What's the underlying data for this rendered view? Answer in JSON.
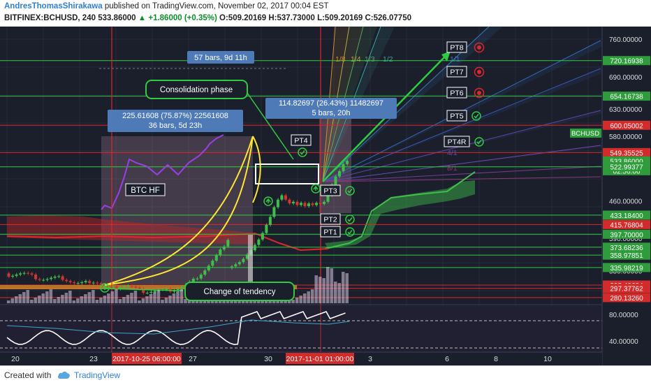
{
  "header": {
    "author": "AndresThomasShirakawa",
    "published_text": "published on TradingView.com, November 02, 2017 00:04 EST",
    "symbol": "BITFINEX:BCHUSD, 240",
    "last": "533.86000",
    "change": "▲ +1.86000 (+0.35%)",
    "ohlc_o": "O:509.20169",
    "ohlc_h": "H:537.73000",
    "ohlc_l": "L:509.20169",
    "ohlc_c": "C:526.07750"
  },
  "footer": {
    "created_with": "Created with",
    "brand": "TradingView"
  },
  "colors": {
    "background": "#1b1f2c",
    "grid": "#2b3142",
    "up": "#3fbf4a",
    "down": "#d0352f",
    "axis_bg": "#1b1f2c",
    "green_line": "#2ecc40",
    "red_line": "#e0262a",
    "yellow": "#ffe534",
    "purple": "#9a3fe6",
    "white": "#ffffff",
    "label_blue": "#4f7ab8"
  },
  "price_axis": {
    "ticks": [
      "760.00000",
      "690.00000",
      "630.00000",
      "580.00000",
      "520.00000",
      "460.00000",
      "390.00000",
      "330.00000"
    ],
    "tags": [
      {
        "v": "720.16938",
        "color": "green"
      },
      {
        "v": "654.16738",
        "color": "green"
      },
      {
        "v": "600.05002",
        "color": "red"
      },
      {
        "v": "549.35525",
        "color": "red"
      },
      {
        "v": "533.86000",
        "color": "green"
      },
      {
        "v": "02:56:06",
        "color": "green"
      },
      {
        "v": "522.99377",
        "color": "green"
      },
      {
        "v": "433.18400",
        "color": "green"
      },
      {
        "v": "415.76804",
        "color": "red"
      },
      {
        "v": "397.70000",
        "color": "green"
      },
      {
        "v": "373.68236",
        "color": "green"
      },
      {
        "v": "358.97851",
        "color": "green"
      },
      {
        "v": "335.98219",
        "color": "green"
      },
      {
        "v": "303.40684",
        "color": "red"
      },
      {
        "v": "297.37762",
        "color": "red"
      },
      {
        "v": "280.13260",
        "color": "red"
      }
    ],
    "symbol_tag": "BCHUSD",
    "rsi_ticks": [
      "80.00000",
      "40.00000"
    ]
  },
  "time_axis": {
    "ticks": [
      "20",
      "23",
      "27",
      "30",
      "3",
      "6",
      "8",
      "10"
    ],
    "highlight_1": "2017-10-25 06:00:00",
    "highlight_2": "2017-11-01 01:00:00"
  },
  "annotations": {
    "bars_note": "57 bars, 9d 11h",
    "consolidation": "Consolidation phase",
    "measure_1_line1": "225.61608 (75.87%) 22561608",
    "measure_1_line2": "36 bars, 5d 23h",
    "measure_2_line1": "114.82697 (26.43%) 11482697",
    "measure_2_line2": "5 bars, 20h",
    "btc_hf": "BTC HF",
    "change_tendency": "Change of tendency",
    "pt1": "PT1",
    "pt2": "PT2",
    "pt3": "PT3",
    "pt4": "PT4",
    "pt4r": "PT4R",
    "pt5": "PT5",
    "pt6": "PT6",
    "pt7": "PT7",
    "pt8": "PT8",
    "fan_1_8": "1/8",
    "fan_1_4": "1/4",
    "fan_1_3": "1/3",
    "fan_1_2": "1/2",
    "fan_1_1": "1/1",
    "fan_4_1": "4/1",
    "fan_8_1": "8/1"
  },
  "chart_data": {
    "type": "candlestick",
    "title": "",
    "symbol": "BITFINEX:BCHUSD",
    "interval": "240",
    "ylim": [
      270,
      780
    ],
    "candles_approx": [
      {
        "t": "Oct 20",
        "c": 330
      },
      {
        "t": "Oct 21",
        "c": 325
      },
      {
        "t": "Oct 22",
        "c": 320
      },
      {
        "t": "Oct 23",
        "c": 315
      },
      {
        "t": "Oct 24",
        "c": 318
      },
      {
        "t": "Oct 25",
        "c": 322
      },
      {
        "t": "Oct 26",
        "c": 335
      },
      {
        "t": "Oct 27",
        "c": 340
      },
      {
        "t": "Oct 28",
        "c": 360
      },
      {
        "t": "Oct 29",
        "c": 400
      },
      {
        "t": "Oct 29b",
        "c": 440
      },
      {
        "t": "Oct 30",
        "c": 450
      },
      {
        "t": "Oct 31",
        "c": 445
      },
      {
        "t": "Nov 1",
        "c": 455
      },
      {
        "t": "Nov 1b",
        "c": 510
      },
      {
        "t": "Nov 2",
        "c": 533.86
      }
    ],
    "horizontal_levels": [
      720.16938,
      654.16738,
      600.05002,
      549.35525,
      522.99377,
      433.184,
      415.76804,
      397.7,
      373.68236,
      358.97851,
      335.98219,
      303.40684,
      297.37762,
      280.1326
    ],
    "rsi": {
      "levels": [
        80,
        40
      ]
    },
    "grid": true
  }
}
